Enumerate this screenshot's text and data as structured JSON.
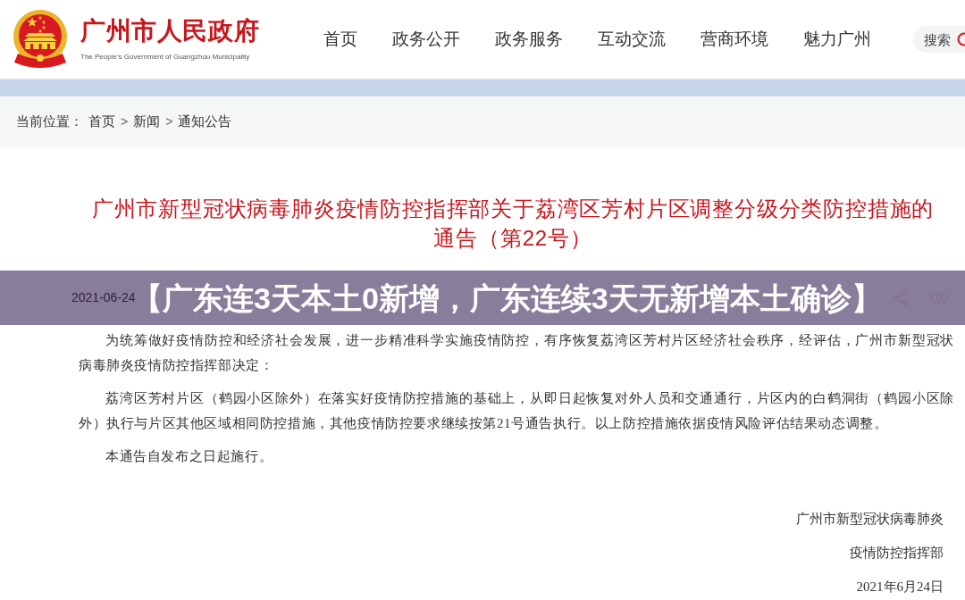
{
  "header": {
    "logo": {
      "title": "广州市人民政府",
      "subtitle": "The People’s Government of Guangzhou Municipality"
    },
    "nav": [
      {
        "label": "首页"
      },
      {
        "label": "政务公开"
      },
      {
        "label": "政务服务"
      },
      {
        "label": "互动交流"
      },
      {
        "label": "营商环境"
      },
      {
        "label": "魅力广州"
      }
    ],
    "search": {
      "placeholder": "搜索"
    }
  },
  "breadcrumb": {
    "label": "当前位置：",
    "items": [
      {
        "kind": "link",
        "text": "首页"
      },
      {
        "kind": "separator",
        "text": ">"
      },
      {
        "kind": "link",
        "text": "新闻"
      },
      {
        "kind": "separator",
        "text": ">"
      },
      {
        "kind": "link",
        "text": "通知公告"
      }
    ]
  },
  "article": {
    "title": "广州市新型冠状病毒肺炎疫情防控指挥部关于荔湾区芳村片区调整分级分类防控措施的通告（第22号）",
    "date": "2021-06-24",
    "paragraphs": [
      "为统筹做好疫情防控和经济社会发展，进一步精准科学实施疫情防控，有序恢复荔湾区芳村片区经济社会秩序，经评估，广州市新型冠状病毒肺炎疫情防控指挥部决定：",
      "荔湾区芳村片区（鹤园小区除外）在落实好疫情防控措施的基础上，从即日起恢复对外人员和交通通行，片区内的白鹤洞街（鹤园小区除外）执行与片区其他区域相同防控措施，其他疫情防控要求继续按第21号通告执行。以上防控措施依据疫情风险评估结果动态调整。",
      "本通告自发布之日起施行。"
    ],
    "signature": [
      "广州市新型冠状病毒肺炎",
      "疫情防控指挥部",
      "2021年6月24日"
    ]
  },
  "overlay_banner": {
    "text": "【广东连3天本土0新增，广东连续3天无新增本土确诊】"
  }
}
